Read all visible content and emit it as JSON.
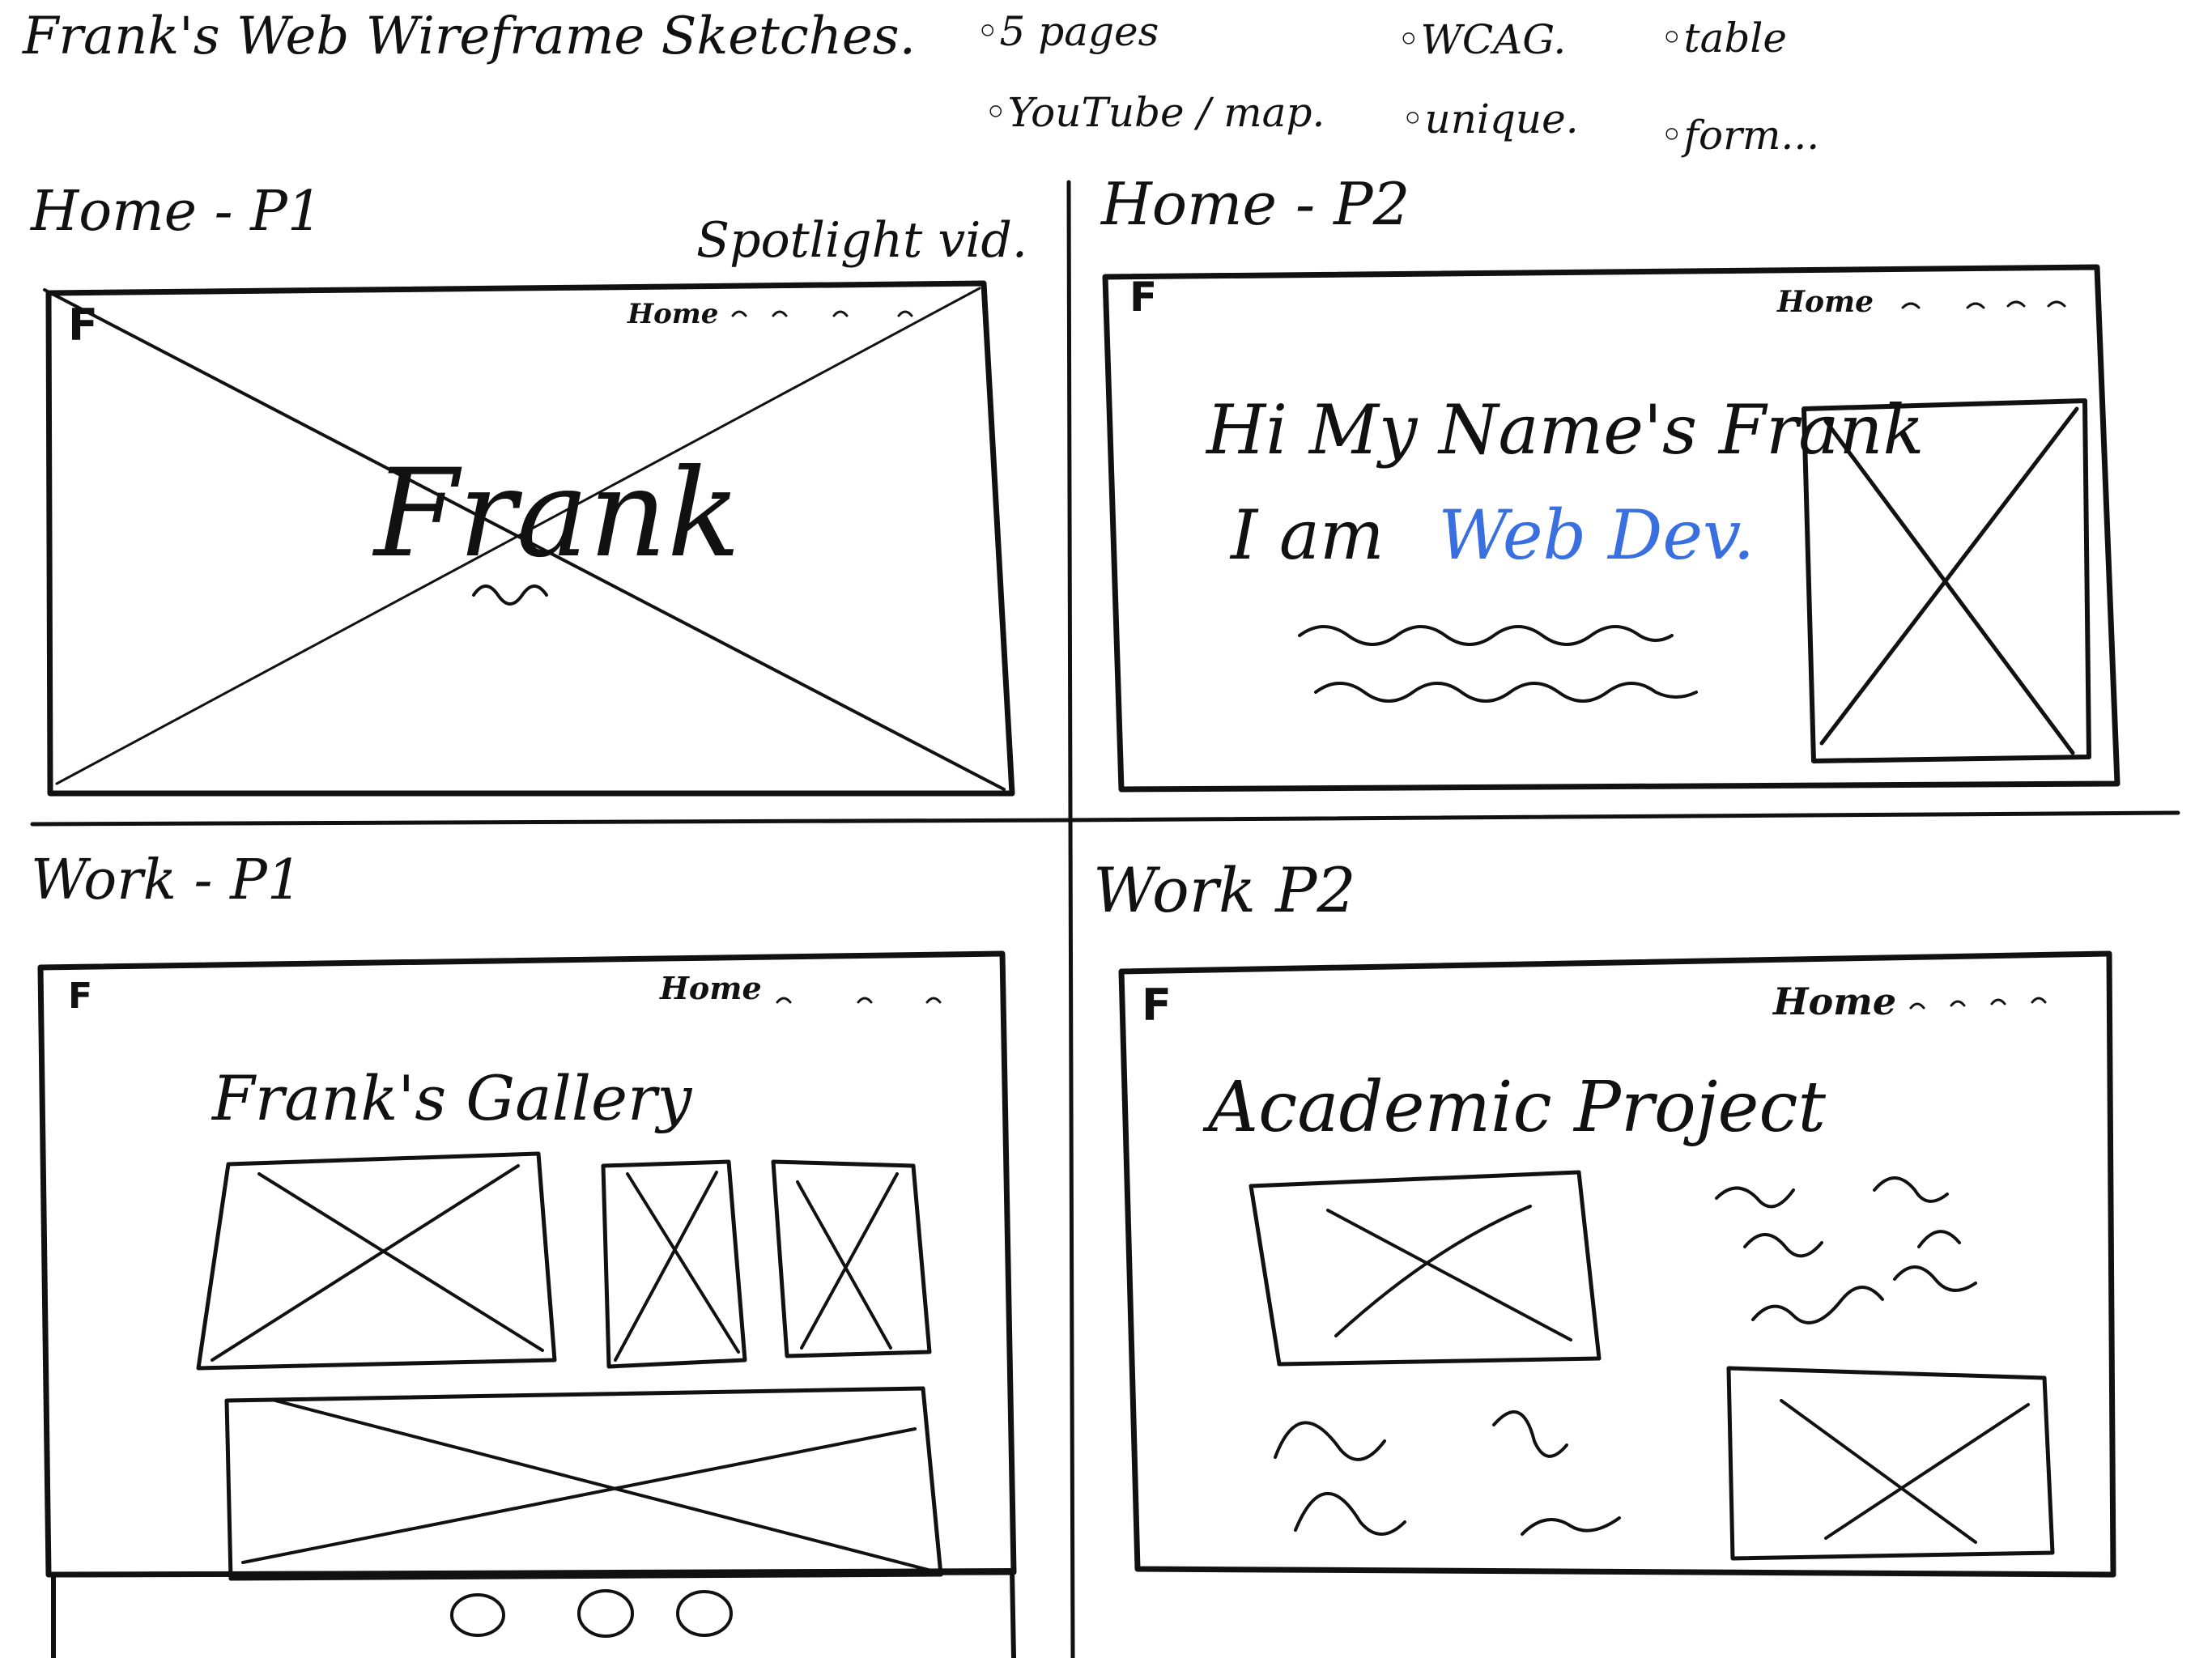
{
  "sheet": {
    "title": "Frank's Web Wireframe Sketches.",
    "requirements": [
      {
        "text": "5 pages"
      },
      {
        "text": "WCAG."
      },
      {
        "text": "table"
      },
      {
        "text": "YouTube / map."
      },
      {
        "text": "unique."
      },
      {
        "text": "form..."
      }
    ]
  },
  "panels": {
    "home_p1": {
      "label": "Home - P1",
      "note": "Spotlight vid.",
      "logo": "F",
      "nav": "Home",
      "hero_text": "Frank"
    },
    "home_p2": {
      "label": "Home - P2",
      "logo": "F",
      "nav": "Home",
      "greeting": "Hi My Name's Frank",
      "intro_prefix": "I am",
      "intro_highlight": "Web Dev."
    },
    "work_p1": {
      "label": "Work - P1",
      "logo": "F",
      "nav": "Home",
      "heading": "Frank's Gallery"
    },
    "work_p2": {
      "label": "Work P2",
      "logo": "F",
      "nav": "Home",
      "heading": "Academic Project"
    }
  },
  "colors": {
    "ink": "#111111",
    "highlight": "#3a6fe0"
  }
}
